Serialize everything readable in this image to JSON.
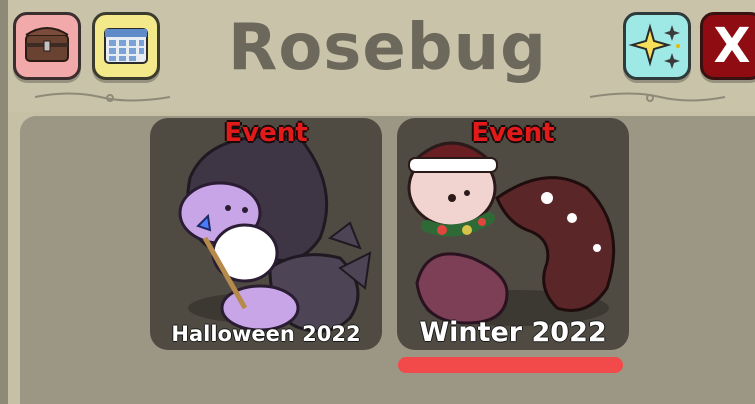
{
  "header": {
    "title": "Rosebug",
    "close_label": "X",
    "inventory_icon": "chest-icon",
    "calendar_icon": "calendar-icon",
    "sparkle_icon": "sparkle-icon"
  },
  "cards": [
    {
      "tag": "Event",
      "caption": "Halloween 2022"
    },
    {
      "tag": "Event",
      "caption": "Winter 2022",
      "selected": true
    }
  ],
  "colors": {
    "close": "#8f0d12",
    "event_tag": "#e21a1a",
    "highlight": "#f24a4a"
  }
}
